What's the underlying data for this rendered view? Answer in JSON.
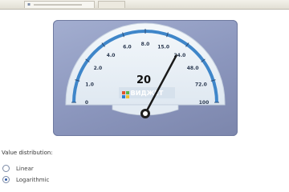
{
  "gauge": {
    "value": 20,
    "value_label": "20",
    "scale_min": 0,
    "scale_max": 100,
    "tick_labels": [
      "0",
      "1.0",
      "2.0",
      "4.0",
      "6.0",
      "8.0",
      "15.0",
      "24.0",
      "48.0",
      "72.0",
      "100"
    ],
    "watermark_text": "ВИДЖЕТ",
    "colors": {
      "panel": "#8e99c1",
      "dial_face": "#eaf1f7",
      "arc": "#3f86c9",
      "needle": "#1a1a1a"
    }
  },
  "value_distribution": {
    "title": "Value distribution:",
    "options": [
      {
        "label": "Linear",
        "selected": false
      },
      {
        "label": "Logarithmic",
        "selected": true
      }
    ]
  },
  "icons": [
    "window-icon",
    "flag-icon"
  ]
}
